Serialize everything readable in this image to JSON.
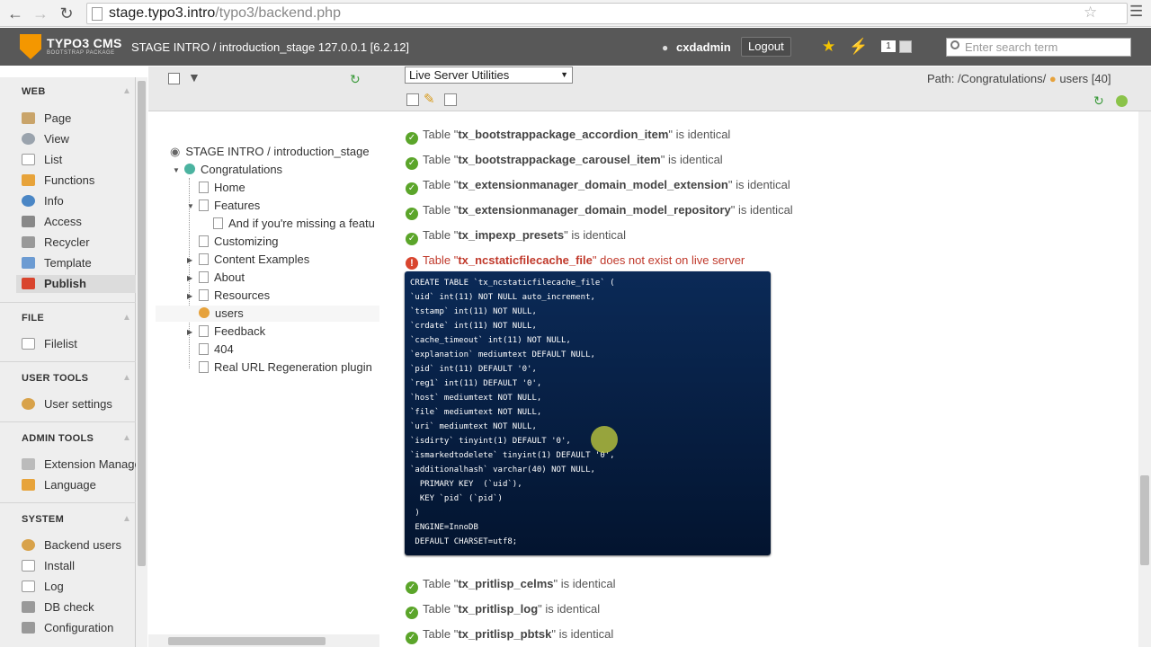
{
  "browser": {
    "url_host": "stage.typo3.intro",
    "url_path": "/typo3/backend.php"
  },
  "topbar": {
    "logo_title": "TYPO3 CMS",
    "logo_subtitle": "BOOTSTRAP PACKAGE",
    "site": "STAGE INTRO / introduction_stage 127.0.0.1 [6.2.12]",
    "username": "cxdadmin",
    "logout": "Logout",
    "count": "1",
    "search_placeholder": "Enter search term"
  },
  "modules": {
    "groups": [
      {
        "label": "WEB",
        "items": [
          "Page",
          "View",
          "List",
          "Functions",
          "Info",
          "Access",
          "Recycler",
          "Template",
          "Publish"
        ]
      },
      {
        "label": "FILE",
        "items": [
          "Filelist"
        ]
      },
      {
        "label": "USER TOOLS",
        "items": [
          "User settings"
        ]
      },
      {
        "label": "ADMIN TOOLS",
        "items": [
          "Extension Manager",
          "Language"
        ]
      },
      {
        "label": "SYSTEM",
        "items": [
          "Backend users",
          "Install",
          "Log",
          "DB check",
          "Configuration"
        ]
      }
    ],
    "active": "Publish"
  },
  "tree": {
    "root": "STAGE INTRO / introduction_stage",
    "nodes": [
      "Congratulations",
      "Home",
      "Features",
      "And if you're missing a featu",
      "Customizing",
      "Content Examples",
      "About",
      "Resources",
      "users",
      "Feedback",
      "404",
      "Real URL Regeneration plugin"
    ]
  },
  "docheader": {
    "function_select": "Live Server Utilities",
    "path_label": "Path: /Congratulations/",
    "path_page": "users [40]"
  },
  "content": {
    "table_word": "Table",
    "rows_before": [
      {
        "table": "tx_bootstrappackage_accordion_item",
        "status": "is identical"
      },
      {
        "table": "tx_bootstrappackage_carousel_item",
        "status": "is identical"
      },
      {
        "table": "tx_extensionmanager_domain_model_extension",
        "status": "is identical"
      },
      {
        "table": "tx_extensionmanager_domain_model_repository",
        "status": "is identical"
      },
      {
        "table": "tx_impexp_presets",
        "status": "is identical"
      }
    ],
    "missing_row": {
      "table": "tx_ncstaticfilecache_file",
      "status": "does not exist on live server"
    },
    "sql": [
      "CREATE TABLE `tx_ncstaticfilecache_file` (",
      "`uid` int(11) NOT NULL auto_increment,",
      "`tstamp` int(11) NOT NULL,",
      "`crdate` int(11) NOT NULL,",
      "`cache_timeout` int(11) NOT NULL,",
      "`explanation` mediumtext DEFAULT NULL,",
      "`pid` int(11) DEFAULT '0',",
      "`reg1` int(11) DEFAULT '0',",
      "`host` mediumtext NOT NULL,",
      "`file` mediumtext NOT NULL,",
      "`uri` mediumtext NOT NULL,",
      "`isdirty` tinyint(1) DEFAULT '0',",
      "`ismarkedtodelete` tinyint(1) DEFAULT '0',",
      "`additionalhash` varchar(40) NOT NULL,",
      "  PRIMARY KEY  (`uid`),",
      "  KEY `pid` (`pid`)",
      " )",
      " ENGINE=InnoDB",
      " DEFAULT CHARSET=utf8;"
    ],
    "rows_after": [
      {
        "table": "tx_pritlisp_celms",
        "status": "is identical"
      },
      {
        "table": "tx_pritlisp_log",
        "status": "is identical"
      },
      {
        "table": "tx_pritlisp_pbtsk",
        "status": "is identical"
      }
    ]
  },
  "colors": {
    "topbar": "#585858",
    "accent": "#f49700",
    "ok": "#5ba52a",
    "error": "#d9452e",
    "sql_bg": "#0b2a57"
  }
}
